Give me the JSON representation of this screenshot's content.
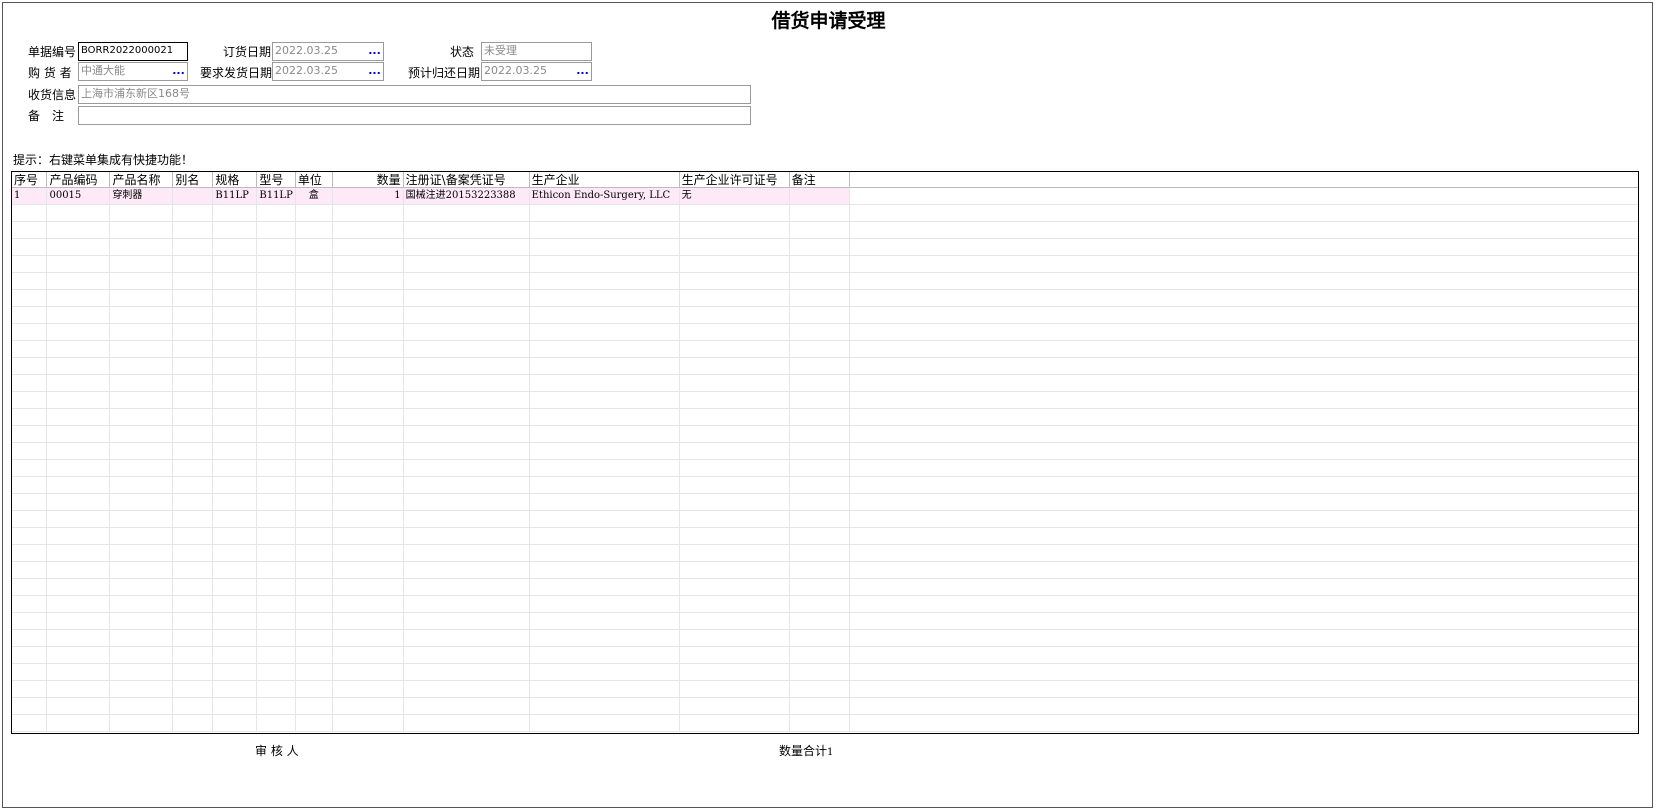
{
  "page": {
    "title": "借货申请受理"
  },
  "form": {
    "doc_no": {
      "label": "单据编号",
      "value": "BORR2022000021"
    },
    "order_date": {
      "label": "订货日期",
      "value": "2022.03.25",
      "picker": "..."
    },
    "status": {
      "label": "状态",
      "value": "未受理"
    },
    "buyer": {
      "label": "购 货 者",
      "value": "中通大能",
      "picker": "..."
    },
    "ship_date": {
      "label": "要求发货日期",
      "value": "2022.03.25",
      "picker": "..."
    },
    "return_date": {
      "label": "预计归还日期",
      "value": "2022.03.25",
      "picker": "..."
    },
    "address": {
      "label": "收货信息",
      "value": "上海市浦东新区168号"
    },
    "remark": {
      "label": "备　注",
      "value": ""
    }
  },
  "hint": "提示：右键菜单集成有快捷功能！",
  "grid": {
    "columns": [
      "序号",
      "产品编码",
      "产品名称",
      "别名",
      "规格",
      "型号",
      "单位",
      "数量",
      "注册证\\备案凭证号",
      "生产企业",
      "生产企业许可证号",
      "备注"
    ],
    "rows": [
      [
        "1",
        "00015",
        "穿刺器",
        "",
        "B11LP",
        "B11LP",
        "盒",
        "1",
        "国械注进20153223388",
        "Ethicon Endo-Surgery, LLC",
        "无",
        ""
      ]
    ],
    "empty_rows": 31
  },
  "footer": {
    "reviewer_label": "审 核 人",
    "total_label": "数量合计",
    "total_value": "1"
  },
  "colors": {
    "selected_row": "#fde9f7",
    "picker_dots": "#0000c8"
  }
}
